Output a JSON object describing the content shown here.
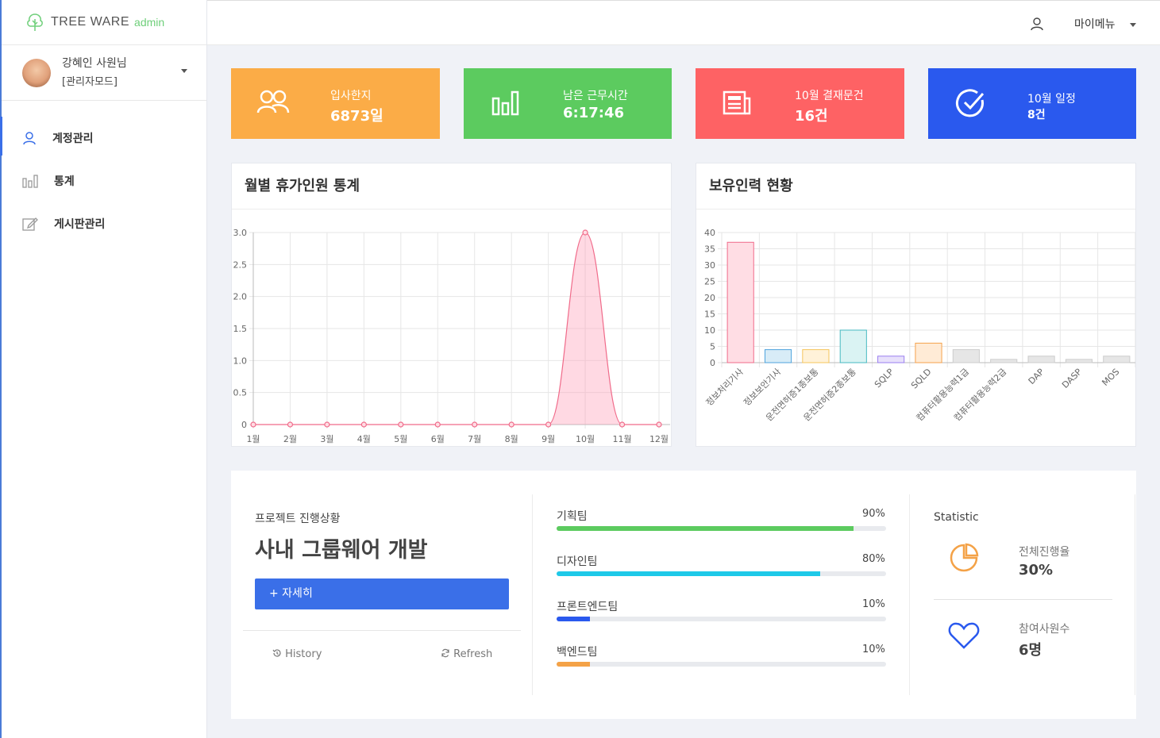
{
  "app": {
    "logo_text": "TREE WARE",
    "logo_sub": "admin"
  },
  "user": {
    "name": "강혜인 사원님",
    "mode": "[관리자모드]"
  },
  "sidebar": {
    "items": [
      {
        "label": "계정관리",
        "icon": "user-icon",
        "active": true
      },
      {
        "label": "통계",
        "icon": "bar-chart-icon",
        "active": false
      },
      {
        "label": "게시판관리",
        "icon": "edit-icon",
        "active": false
      }
    ]
  },
  "header": {
    "menu_label": "마이메뉴"
  },
  "cards": [
    {
      "label": "입사한지",
      "value": "6873일",
      "color": "#fbac47",
      "icon": "people-icon"
    },
    {
      "label": "남은 근무시간",
      "value": "6:17:46",
      "color": "#5ccb5f",
      "icon": "bar-chart-icon"
    },
    {
      "label": "10월 결재문건",
      "value": "16건",
      "color": "#fe6264",
      "icon": "newspaper-icon"
    },
    {
      "label": "10월 일정",
      "value": "8건",
      "color": "#2a59ee",
      "icon": "check-circle-icon"
    }
  ],
  "vacation_chart": {
    "title": "월별 휴가인원 통계"
  },
  "skill_chart": {
    "title": "보유인력 현황"
  },
  "chart_data": [
    {
      "type": "area",
      "title": "월별 휴가인원 통계",
      "categories": [
        "1월",
        "2월",
        "3월",
        "4월",
        "5월",
        "6월",
        "7월",
        "8월",
        "9월",
        "10월",
        "11월",
        "12월"
      ],
      "values": [
        0,
        0,
        0,
        0,
        0,
        0,
        0,
        0,
        0,
        3,
        0,
        0
      ],
      "ylim": [
        0,
        3
      ],
      "yticks": [
        "0",
        "0.5",
        "1.0",
        "1.5",
        "2.0",
        "2.5",
        "3.0"
      ],
      "color": "#f06b8a",
      "grid": true
    },
    {
      "type": "bar",
      "title": "보유인력 현황",
      "categories": [
        "정보처리기사",
        "정보보안기사",
        "운전면허증1종보통",
        "운전면허증2종보통",
        "SQLP",
        "SQLD",
        "컴퓨터활용능력1급",
        "컴퓨터활용능력2급",
        "DAP",
        "DASP",
        "MOS"
      ],
      "values": [
        37,
        4,
        4,
        10,
        2,
        6,
        4,
        1,
        2,
        1,
        2
      ],
      "ylim": [
        0,
        40
      ],
      "yticks": [
        "0",
        "5",
        "10",
        "15",
        "20",
        "25",
        "30",
        "35",
        "40"
      ],
      "colors": [
        "#ffdde4",
        "#d8ecf7",
        "#fff2d9",
        "#daf3f3",
        "#e8e1fb",
        "#ffebd6",
        "#e6e6e6",
        "#e6e6e6",
        "#e6e6e6",
        "#e6e6e6",
        "#e6e6e6"
      ],
      "borders": [
        "#f06b8a",
        "#4ea3dd",
        "#f5c55c",
        "#46b9c0",
        "#9a7ef0",
        "#f5a24c",
        "#cccccc",
        "#cccccc",
        "#cccccc",
        "#cccccc",
        "#cccccc"
      ],
      "grid": true
    }
  ],
  "project": {
    "label": "프로젝트 진행상황",
    "title": "사내 그룹웨어 개발",
    "button": "+ 자세히",
    "history": "History",
    "refresh": "Refresh"
  },
  "teams": [
    {
      "name": "기획팀",
      "pct_label": "90%",
      "pct": 90,
      "color": "#5ccb5f"
    },
    {
      "name": "디자인팀",
      "pct_label": "80%",
      "pct": 80,
      "color": "#1ec9e8"
    },
    {
      "name": "프론트엔드팀",
      "pct_label": "10%",
      "pct": 10,
      "color": "#2a59ee"
    },
    {
      "name": "백엔드팀",
      "pct_label": "10%",
      "pct": 10,
      "color": "#f4a247"
    }
  ],
  "statistic": {
    "title": "Statistic",
    "progress_label": "전체진행율",
    "progress_value": "30%",
    "members_label": "참여사원수",
    "members_value": "6명"
  }
}
